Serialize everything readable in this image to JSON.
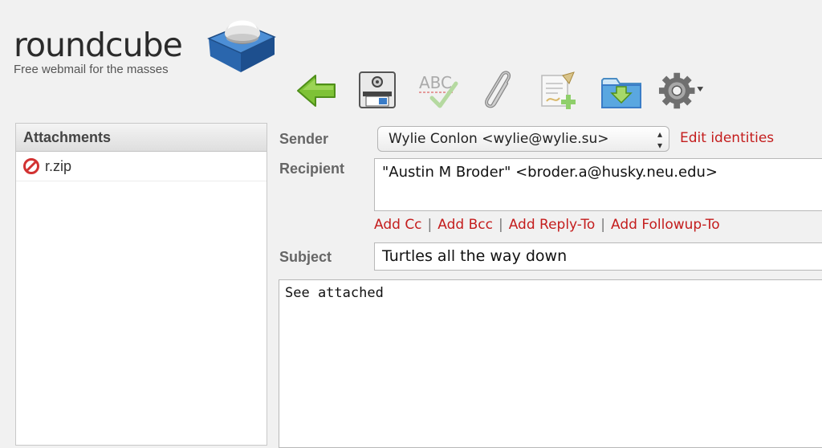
{
  "logo": {
    "wordmark": "roundcube",
    "tagline": "Free webmail for the masses"
  },
  "toolbar": {
    "buttons": [
      {
        "name": "back",
        "icon": "back-arrow-icon"
      },
      {
        "name": "send",
        "icon": "send-mail-icon"
      },
      {
        "name": "spell",
        "icon": "spellcheck-icon"
      },
      {
        "name": "attach",
        "icon": "paperclip-icon"
      },
      {
        "name": "signature",
        "icon": "signature-icon"
      },
      {
        "name": "save",
        "icon": "save-draft-icon"
      },
      {
        "name": "options",
        "icon": "gear-icon"
      }
    ]
  },
  "attachments": {
    "header": "Attachments",
    "items": [
      {
        "filename": "r.zip",
        "icon": "delete-icon"
      }
    ]
  },
  "form": {
    "sender_label": "Sender",
    "sender_value": "Wylie Conlon <wylie@wylie.su>",
    "edit_identities": "Edit identities",
    "recipient_label": "Recipient",
    "recipient_value": "\"Austin M Broder\" <broder.a@husky.neu.edu>",
    "add_cc": "Add Cc",
    "add_bcc": "Add Bcc",
    "add_reply_to": "Add Reply-To",
    "add_followup_to": "Add Followup-To",
    "separator": "|",
    "subject_label": "Subject",
    "subject_value": "Turtles all the way down",
    "body": "See attached"
  },
  "colors": {
    "link": "#c41d1d",
    "background": "#f1f1f1",
    "logo_blue": "#3a7cc7"
  }
}
